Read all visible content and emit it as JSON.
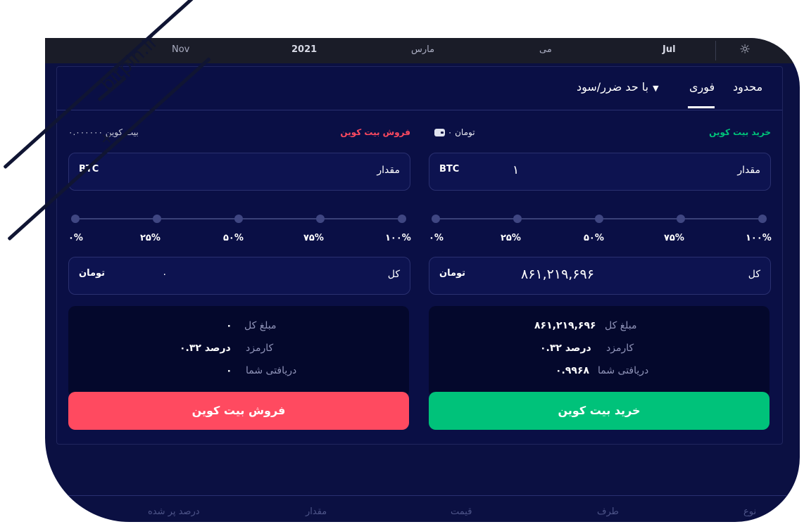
{
  "timeline": {
    "labels": [
      "Nov",
      "2021",
      "مارس",
      "می",
      "Jul"
    ]
  },
  "tabs": {
    "limit": "محدود",
    "instant": "فوری",
    "stop": "با حد ضرر/سود",
    "stop_caret": "▼"
  },
  "buy": {
    "title": "خرید بیت کوین",
    "balance": "۰ تومان",
    "amount_label": "مقدار",
    "amount_unit": "BTC",
    "amount_value": "۱",
    "percents": [
      "۱۰۰%",
      "۷۵%",
      "۵۰%",
      "۲۵%",
      "۰%"
    ],
    "total_label": "کل",
    "total_unit": "تومان",
    "total_value": "۸۶۱,۲۱۹,۶۹۶",
    "summary": {
      "total_label": "مبلغ کل",
      "total_value": "۸۶۱,۲۱۹,۶۹۶",
      "fee_label": "کارمزد",
      "fee_value": "۰.۳۲ درصد",
      "receive_label": "دریافتی شما",
      "receive_value": "۰.۹۹۶۸"
    },
    "button": "خرید بیت کوین",
    "color": "#00c27a"
  },
  "sell": {
    "title": "فروش بیت کوین",
    "balance": "۰.۰۰۰۰۰۰ بیت کوین",
    "amount_label": "مقدار",
    "amount_unit": "BTC",
    "percents": [
      "۱۰۰%",
      "۷۵%",
      "۵۰%",
      "۲۵%",
      "۰%"
    ],
    "total_label": "کل",
    "total_unit": "تومان",
    "total_value": "۰",
    "summary": {
      "total_label": "مبلغ کل",
      "total_value": "۰",
      "fee_label": "کارمزد",
      "fee_value": "۰.۳۲ درصد",
      "receive_label": "دریافتی شما",
      "receive_value": "۰"
    },
    "button": "فروش بیت کوین",
    "color": "#ff4a60"
  },
  "orders_table": {
    "columns": [
      "نوع",
      "طرف",
      "قیمت",
      "مقدار",
      "درصد پر شده"
    ]
  },
  "watermark": {
    "text": "bitpin.ir"
  }
}
